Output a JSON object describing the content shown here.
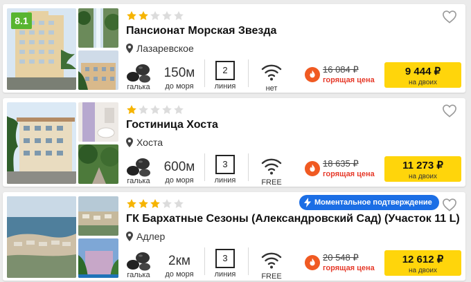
{
  "colors": {
    "accent": "#ffd50b",
    "rating_bg": "#58b530",
    "hot": "#e63a2a",
    "star_on": "#f6b400",
    "star_off": "#dcdcdc",
    "badge": "#1b6ee5"
  },
  "icons": [
    "heart-icon",
    "star-icon",
    "pin-icon",
    "pebbles-icon",
    "wifi-icon",
    "fire-icon",
    "lightning-icon"
  ],
  "hotels": [
    {
      "rating": "8.1",
      "stars": 2,
      "name": "Пансионат Морская Звезда",
      "location": "Лазаревское",
      "beach_label": "галька",
      "distance": "150м",
      "distance_label": "до моря",
      "line": "2",
      "line_label": "линия",
      "wifi": "нет",
      "old_price": "16 084 ₽",
      "hot_label": "горящая цена",
      "price": "9 444 ₽",
      "price_note": "на двоих"
    },
    {
      "stars": 1,
      "name": "Гостиница Хоста",
      "location": "Хоста",
      "beach_label": "галька",
      "distance": "600м",
      "distance_label": "до моря",
      "line": "3",
      "line_label": "линия",
      "wifi": "FREE",
      "old_price": "18 635 ₽",
      "hot_label": "горящая цена",
      "price": "11 273 ₽",
      "price_note": "на двоих"
    },
    {
      "badge": "Моментальное подтверждение",
      "stars": 3,
      "name": "ГК Бархатные Сезоны (Александровский Сад) (Участок 11 L)",
      "location": "Адлер",
      "beach_label": "галька",
      "distance": "2км",
      "distance_label": "до моря",
      "line": "3",
      "line_label": "линия",
      "wifi": "FREE",
      "old_price": "20 548 ₽",
      "hot_label": "горящая цена",
      "price": "12 612 ₽",
      "price_note": "на двоих"
    }
  ]
}
